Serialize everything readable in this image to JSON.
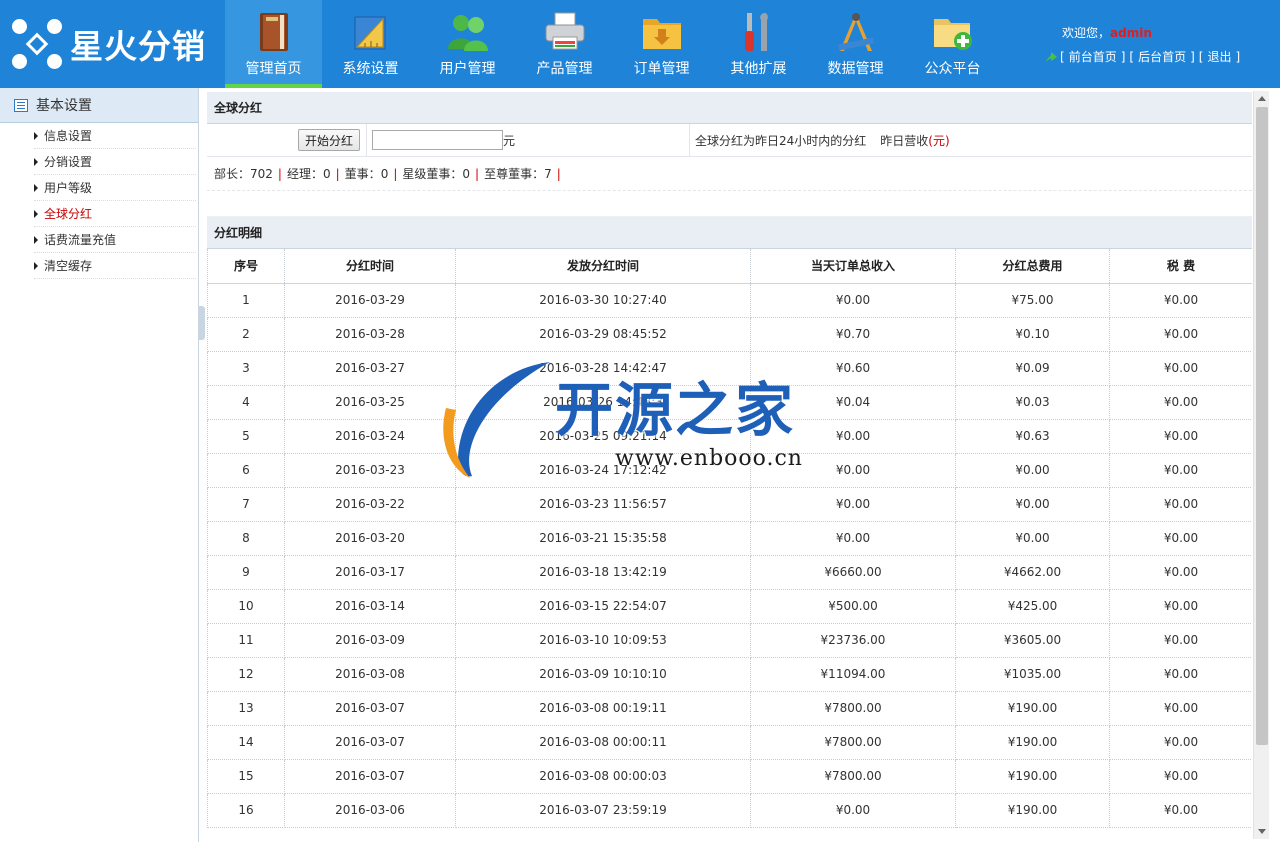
{
  "app": {
    "logo_text": "星火分销"
  },
  "nav": [
    {
      "label": "管理首页",
      "icon": "book-icon",
      "active": true
    },
    {
      "label": "系统设置",
      "icon": "ruler-icon",
      "active": false
    },
    {
      "label": "用户管理",
      "icon": "users-icon",
      "active": false
    },
    {
      "label": "产品管理",
      "icon": "printer-icon",
      "active": false
    },
    {
      "label": "订单管理",
      "icon": "folder-icon",
      "active": false
    },
    {
      "label": "其他扩展",
      "icon": "tools-icon",
      "active": false
    },
    {
      "label": "数据管理",
      "icon": "drafting-icon",
      "active": false
    },
    {
      "label": "公众平台",
      "icon": "folder-add-icon",
      "active": false
    }
  ],
  "header": {
    "welcome": "欢迎您，",
    "username": "admin",
    "links": [
      "前台首页",
      "后台首页",
      "退出"
    ]
  },
  "sidebar": {
    "title": "基本设置",
    "items": [
      {
        "label": "信息设置",
        "active": false
      },
      {
        "label": "分销设置",
        "active": false
      },
      {
        "label": "用户等级",
        "active": false
      },
      {
        "label": "全球分红",
        "active": true
      },
      {
        "label": "话费流量充值",
        "active": false
      },
      {
        "label": "清空缓存",
        "active": false
      }
    ]
  },
  "global_dividend": {
    "title": "全球分红",
    "start_button": "开始分红",
    "amount_value": "",
    "unit": "元",
    "note": "全球分红为昨日24小时内的分红",
    "revenue_label": "昨日营收",
    "revenue_unit": "(元)"
  },
  "stats": [
    {
      "label": "部长：",
      "value": "702"
    },
    {
      "label": "经理：",
      "value": "0"
    },
    {
      "label": "董事：",
      "value": "0"
    },
    {
      "label": "星级董事：",
      "value": "0"
    },
    {
      "label": "至尊董事：",
      "value": "7"
    }
  ],
  "detail": {
    "title": "分红明细",
    "columns": [
      "序号",
      "分红时间",
      "发放分红时间",
      "当天订单总收入",
      "分红总费用",
      "税 费"
    ],
    "rows": [
      [
        "1",
        "2016-03-29",
        "2016-03-30 10:27:40",
        "¥0.00",
        "¥75.00",
        "¥0.00"
      ],
      [
        "2",
        "2016-03-28",
        "2016-03-29 08:45:52",
        "¥0.70",
        "¥0.10",
        "¥0.00"
      ],
      [
        "3",
        "2016-03-27",
        "2016-03-28 14:42:47",
        "¥0.60",
        "¥0.09",
        "¥0.00"
      ],
      [
        "4",
        "2016-03-25",
        "2016-03-26 14:48:3",
        "¥0.04",
        "¥0.03",
        "¥0.00"
      ],
      [
        "5",
        "2016-03-24",
        "2016-03-25 09:21:14",
        "¥0.00",
        "¥0.63",
        "¥0.00"
      ],
      [
        "6",
        "2016-03-23",
        "2016-03-24 17:12:42",
        "¥0.00",
        "¥0.00",
        "¥0.00"
      ],
      [
        "7",
        "2016-03-22",
        "2016-03-23 11:56:57",
        "¥0.00",
        "¥0.00",
        "¥0.00"
      ],
      [
        "8",
        "2016-03-20",
        "2016-03-21 15:35:58",
        "¥0.00",
        "¥0.00",
        "¥0.00"
      ],
      [
        "9",
        "2016-03-17",
        "2016-03-18 13:42:19",
        "¥6660.00",
        "¥4662.00",
        "¥0.00"
      ],
      [
        "10",
        "2016-03-14",
        "2016-03-15 22:54:07",
        "¥500.00",
        "¥425.00",
        "¥0.00"
      ],
      [
        "11",
        "2016-03-09",
        "2016-03-10 10:09:53",
        "¥23736.00",
        "¥3605.00",
        "¥0.00"
      ],
      [
        "12",
        "2016-03-08",
        "2016-03-09 10:10:10",
        "¥11094.00",
        "¥1035.00",
        "¥0.00"
      ],
      [
        "13",
        "2016-03-07",
        "2016-03-08 00:19:11",
        "¥7800.00",
        "¥190.00",
        "¥0.00"
      ],
      [
        "14",
        "2016-03-07",
        "2016-03-08 00:00:11",
        "¥7800.00",
        "¥190.00",
        "¥0.00"
      ],
      [
        "15",
        "2016-03-07",
        "2016-03-08 00:00:03",
        "¥7800.00",
        "¥190.00",
        "¥0.00"
      ],
      [
        "16",
        "2016-03-06",
        "2016-03-07 23:59:19",
        "¥0.00",
        "¥190.00",
        "¥0.00"
      ]
    ]
  },
  "watermark": {
    "text": "开源之家",
    "url": "www.enbooo.cn"
  }
}
